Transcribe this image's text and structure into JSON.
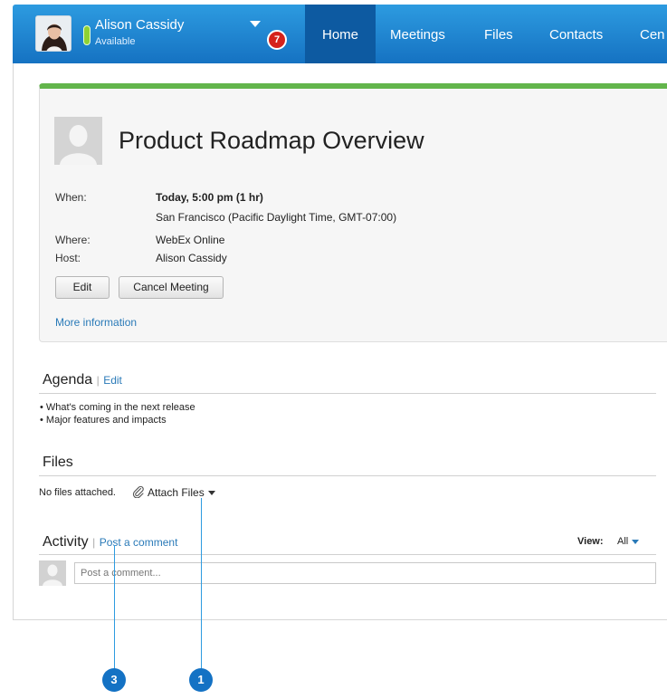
{
  "user": {
    "name": "Alison Cassidy",
    "status": "Available",
    "notifications": "7"
  },
  "nav": {
    "tabs": [
      {
        "label": "Home",
        "active": true
      },
      {
        "label": "Meetings"
      },
      {
        "label": "Files"
      },
      {
        "label": "Contacts"
      },
      {
        "label": "Cen"
      }
    ]
  },
  "meeting": {
    "title": "Product Roadmap Overview",
    "when_label": "When:",
    "when_value": "Today, 5:00 pm  (1 hr)",
    "timezone": "San Francisco (Pacific Daylight Time, GMT-07:00)",
    "where_label": "Where:",
    "where_value": "WebEx Online",
    "host_label": "Host:",
    "host_value": "Alison Cassidy",
    "edit_button": "Edit",
    "cancel_button": "Cancel Meeting",
    "more_info": "More information"
  },
  "agenda": {
    "title": "Agenda",
    "separator": "|",
    "edit_link": "Edit",
    "items": [
      "• What's coming in the next release",
      "• Major features and impacts"
    ]
  },
  "files": {
    "title": "Files",
    "empty_text": "No files attached.",
    "attach_link": "Attach Files"
  },
  "activity": {
    "title": "Activity",
    "separator": "|",
    "post_link": "Post a comment",
    "view_label": "View:",
    "view_value": "All",
    "comment_placeholder": "Post a comment..."
  },
  "callouts": [
    "3",
    "1"
  ],
  "colors": {
    "nav_blue": "#1e86d4",
    "nav_active": "#0d5aa1",
    "card_accent": "#63b54b",
    "link": "#2a7ab8",
    "badge_red": "#d5221b",
    "callout_blue": "#1472c4"
  }
}
